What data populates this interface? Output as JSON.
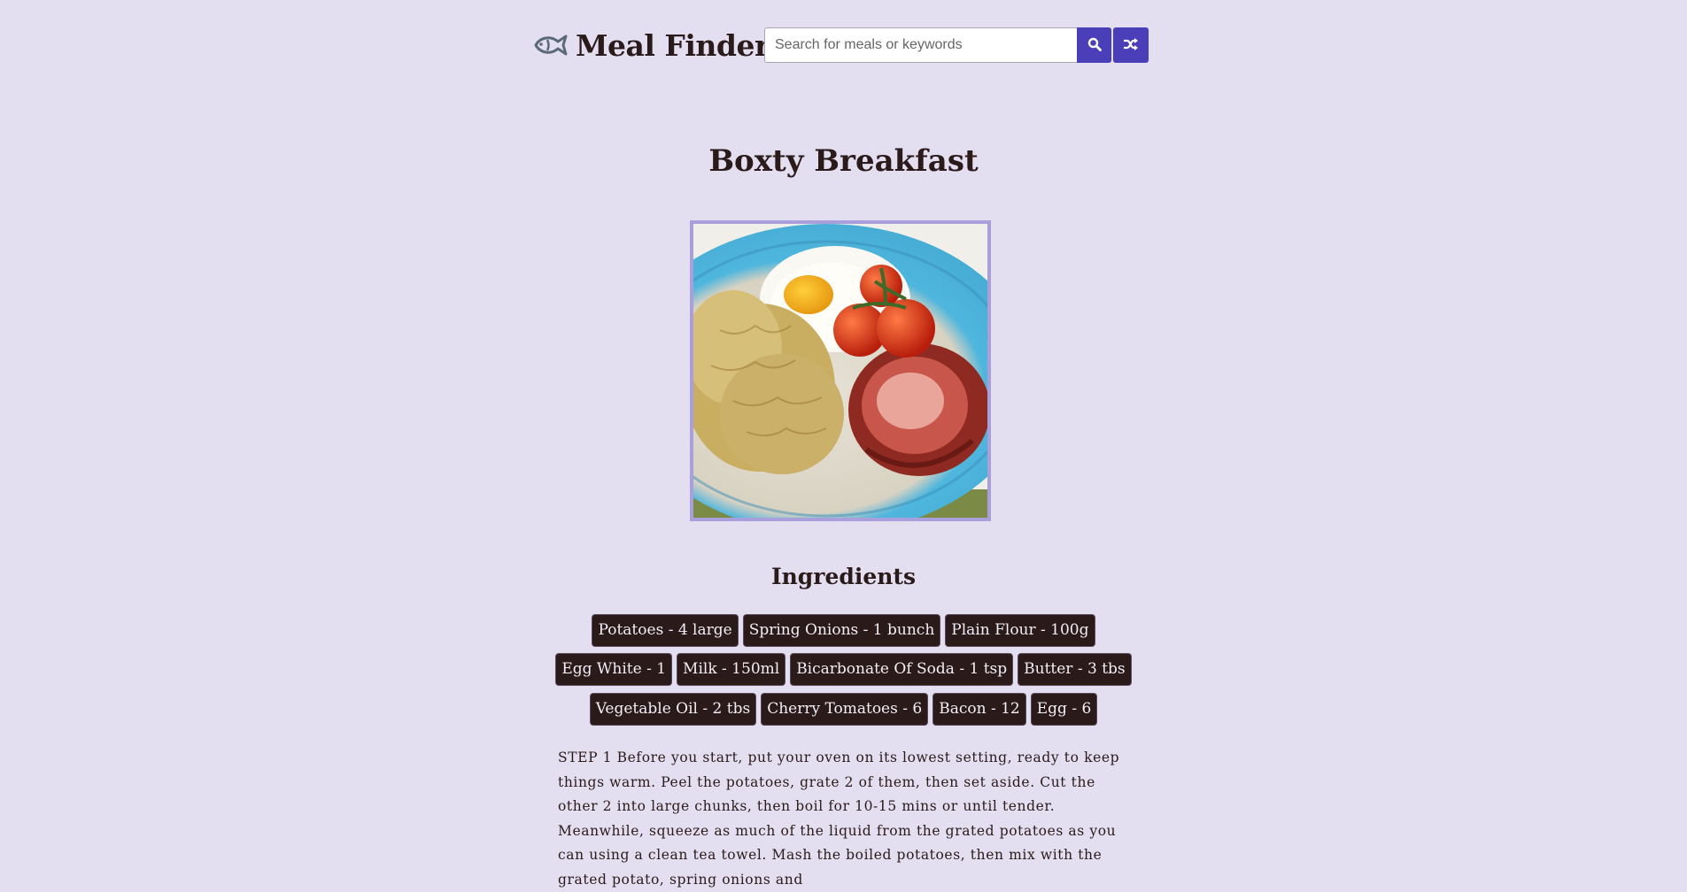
{
  "app": {
    "title": "Meal Finder",
    "logo_icon": "fish-icon"
  },
  "search": {
    "placeholder": "Search for meals or keywords",
    "value": "",
    "submit_icon": "search-icon",
    "random_icon": "shuffle-icon"
  },
  "colors": {
    "background": "#e3dff0",
    "accent": "#4a3fb8",
    "tag_background": "#2b1a1a",
    "image_border": "#a99fdc"
  },
  "meal": {
    "title": "Boxty Breakfast",
    "ingredients_heading": "Ingredients",
    "ingredient_rows": [
      [
        "Potatoes - 4 large",
        "Spring Onions - 1 bunch",
        "Plain Flour - 100g"
      ],
      [
        "Egg White - 1",
        "Milk - 150ml",
        "Bicarbonate Of Soda - 1 tsp",
        "Butter - 3 tbs"
      ],
      [
        "Vegetable Oil - 2 tbs",
        "Cherry Tomatoes - 6",
        "Bacon - 12",
        "Egg - 6"
      ]
    ],
    "instructions": "STEP 1 Before you start, put your oven on its lowest setting, ready to keep things warm. Peel the potatoes, grate 2 of them, then set aside. Cut the other 2 into large chunks, then boil for 10-15 mins or until tender. Meanwhile, squeeze as much of the liquid from the grated potatoes as you can using a clean tea towel. Mash the boiled potatoes, then mix with the grated potato, spring onions and"
  }
}
